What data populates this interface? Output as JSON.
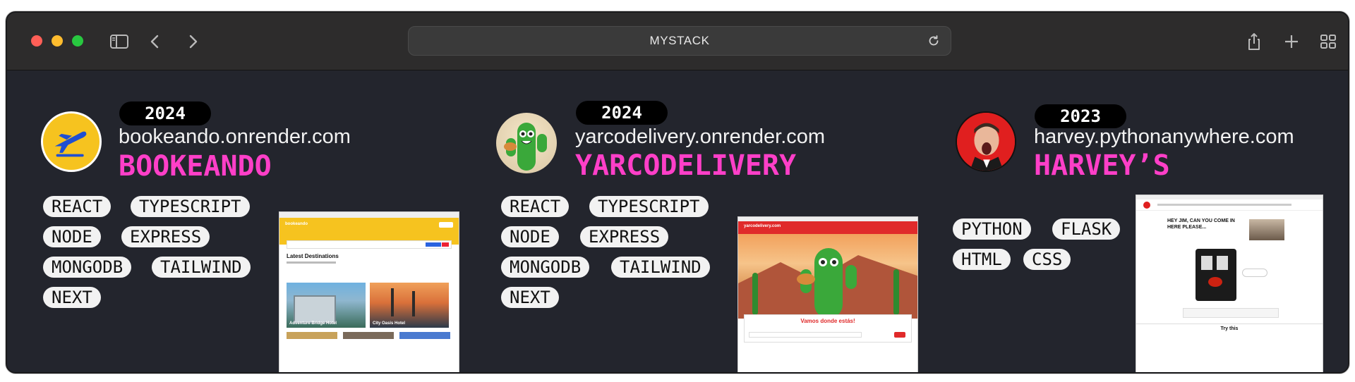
{
  "browser": {
    "url": "MYSTACK",
    "icons": [
      "sidebar-icon",
      "back-icon",
      "forward-icon",
      "reload-icon",
      "share-icon",
      "new-tab-icon",
      "tab-overview-icon"
    ]
  },
  "projects": [
    {
      "year": "2024",
      "domain": "bookeando.onrender.com",
      "name": "BOOKEANDO",
      "tags": [
        "REACT",
        "TYPESCRIPT",
        "NODE",
        "EXPRESS",
        "MONGODB",
        "TAILWIND",
        "NEXT"
      ],
      "preview": {
        "brand": "bookeando",
        "heading": "Latest Destinations",
        "hotels": [
          "Adventure Bridge Hotel",
          "City Oasis Hotel"
        ]
      }
    },
    {
      "year": "2024",
      "domain": "yarcodelivery.onrender.com",
      "name": "YARCODELIVERY",
      "tags": [
        "REACT",
        "TYPESCRIPT",
        "NODE",
        "EXPRESS",
        "MONGODB",
        "TAILWIND",
        "NEXT"
      ],
      "preview": {
        "brand": "yarcodelivery.com",
        "heading": "Vamos donde estás!"
      }
    },
    {
      "year": "2023",
      "domain": "harvey.pythonanywhere.com",
      "name": "HARVEY’S",
      "tags": [
        "PYTHON",
        "FLASK",
        "HTML",
        "CSS"
      ],
      "preview": {
        "quote": "HEY JIM, CAN YOU COME IN HERE PLEASE...",
        "footer": "Try this"
      }
    }
  ],
  "colors": {
    "background": "#23252d",
    "accent": "#ff3fc8",
    "tag_bg": "#f2f2f2"
  }
}
